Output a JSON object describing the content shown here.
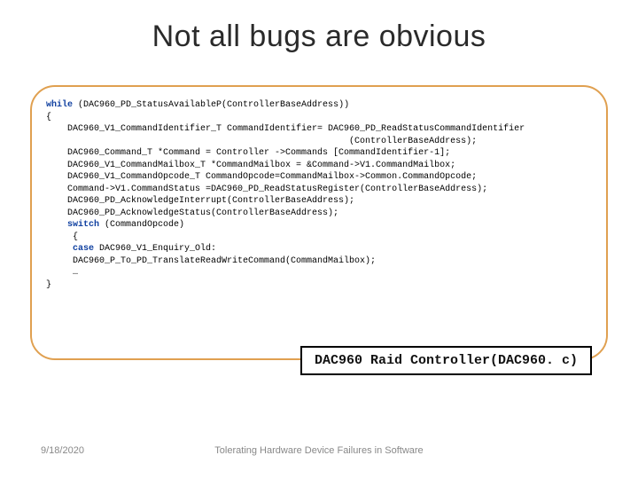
{
  "title": "Not all bugs are obvious",
  "code": {
    "l1a": "while ",
    "l1b": "(DAC960_PD_StatusAvailableP(ControllerBaseAddress))",
    "l2": "{",
    "l3": "    DAC960_V1_CommandIdentifier_T CommandIdentifier= DAC960_PD_ReadStatusCommandIdentifier",
    "l4": "                                                         (ControllerBaseAddress);",
    "l5": "    DAC960_Command_T *Command = Controller ->Commands [CommandIdentifier-1];",
    "l6": "    DAC960_V1_CommandMailbox_T *CommandMailbox = &Command->V1.CommandMailbox;",
    "l7": "    DAC960_V1_CommandOpcode_T CommandOpcode=CommandMailbox->Common.CommandOpcode;",
    "l8": "    Command->V1.CommandStatus =DAC960_PD_ReadStatusRegister(ControllerBaseAddress);",
    "l9": "    DAC960_PD_AcknowledgeInterrupt(ControllerBaseAddress);",
    "l10": "    DAC960_PD_AcknowledgeStatus(ControllerBaseAddress);",
    "l11a": "    switch ",
    "l11b": "(CommandOpcode)",
    "l12": "     {",
    "l13a": "     case ",
    "l13b": "DAC960_V1_Enquiry_Old:",
    "l14": "     DAC960_P_To_PD_TranslateReadWriteCommand(CommandMailbox);",
    "l15": "     …",
    "l16": "}"
  },
  "caption": "DAC960 Raid Controller(DAC960. c)",
  "date": "9/18/2020",
  "footer": "Tolerating Hardware Device Failures in Software"
}
